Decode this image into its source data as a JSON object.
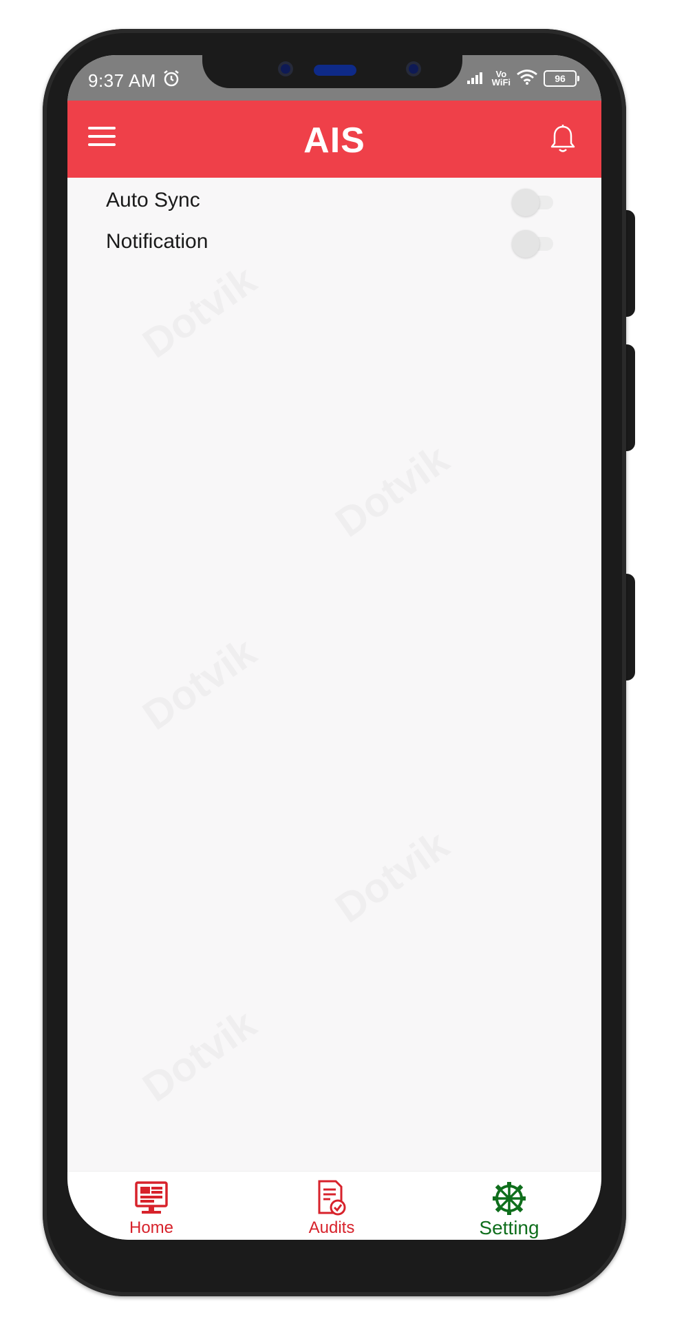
{
  "status_bar": {
    "time": "9:37 AM",
    "vo": "Vo",
    "wifi": "WiFi",
    "battery": "96"
  },
  "app_bar": {
    "title": "AIS"
  },
  "settings": [
    {
      "label": "Auto Sync",
      "enabled": false
    },
    {
      "label": "Notification",
      "enabled": false
    }
  ],
  "bottom_nav": {
    "home": "Home",
    "audits": "Audits",
    "setting": "Setting"
  },
  "watermark": "Dotvik",
  "colors": {
    "primary": "#ef4049",
    "nav_inactive": "#d7222b",
    "nav_active": "#0f6e1c"
  }
}
